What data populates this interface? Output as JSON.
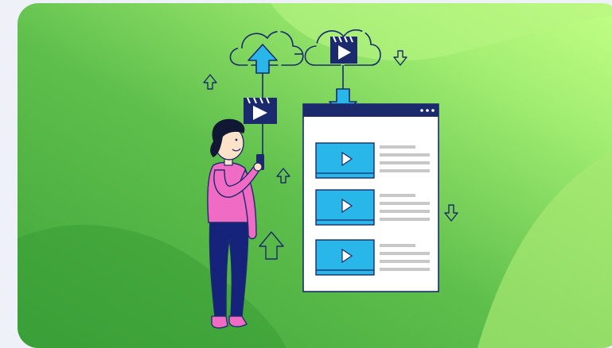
{
  "scene": {
    "subject": "video-upload-to-cloud-illustration",
    "colors": {
      "page_background": "#eef1f8",
      "panel_green_dark": "#3fa43a",
      "panel_green_light": "#c4ff86",
      "outline_navy": "#1a2a6c",
      "accent_blue": "#29b6e8",
      "person_top_pink": "#f06cc4",
      "person_pants_navy": "#16237a",
      "window_white": "#ffffff",
      "text_line_gray": "#c8c8c8"
    },
    "icons": [
      "cloud-icon",
      "video-clapperboard-icon",
      "play-icon",
      "upload-arrow-icon",
      "download-arrow-icon",
      "smartphone-icon",
      "browser-window-icon"
    ]
  }
}
